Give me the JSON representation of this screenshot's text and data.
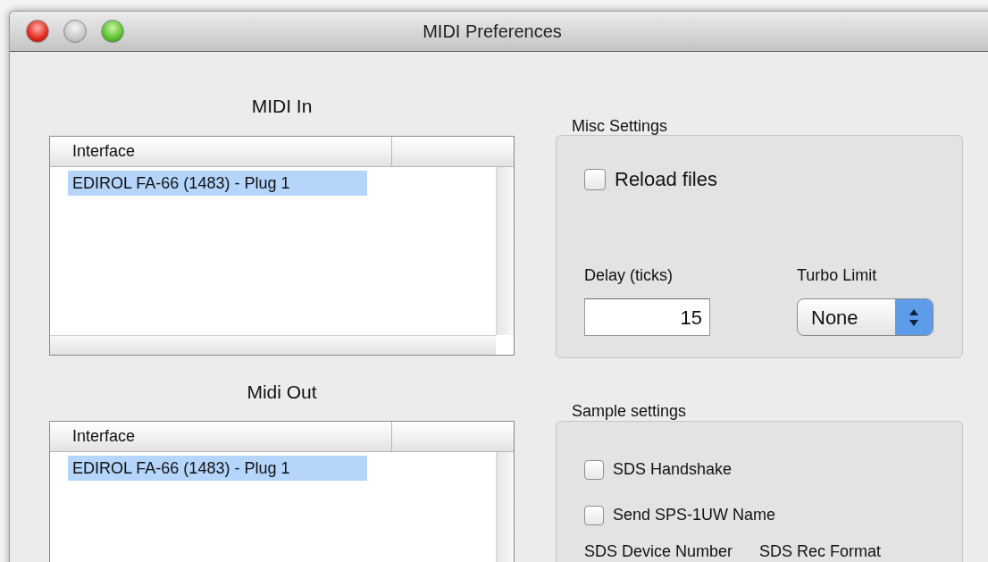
{
  "window": {
    "title": "MIDI Preferences",
    "buttons": [
      {
        "kind": "close",
        "disabled": false
      },
      {
        "kind": "minimize",
        "disabled": true
      },
      {
        "kind": "zoom",
        "disabled": false
      }
    ]
  },
  "midi_in": {
    "title": "MIDI In",
    "columns": [
      "Interface"
    ],
    "rows": [
      {
        "cells": [
          "EDIROL FA-66 (1483) - Plug 1"
        ],
        "selected": true
      }
    ]
  },
  "midi_out": {
    "title": "Midi Out",
    "columns": [
      "Interface"
    ],
    "rows": [
      {
        "cells": [
          "EDIROL FA-66 (1483) - Plug 1"
        ],
        "selected": true
      }
    ]
  },
  "misc_settings": {
    "title": "Misc Settings",
    "checkboxes": [
      {
        "label": "Reload files",
        "checked": false
      }
    ],
    "delay": {
      "label": "Delay (ticks)",
      "value": "15"
    },
    "turbo_limit": {
      "label": "Turbo Limit",
      "value": "None"
    }
  },
  "sample_settings": {
    "title": "Sample settings",
    "checkboxes": [
      {
        "label": "SDS Handshake",
        "checked": false
      },
      {
        "label": "Send SPS-1UW Name",
        "checked": false
      }
    ],
    "field_labels": [
      "SDS Device Number",
      "SDS Rec Format"
    ]
  }
}
